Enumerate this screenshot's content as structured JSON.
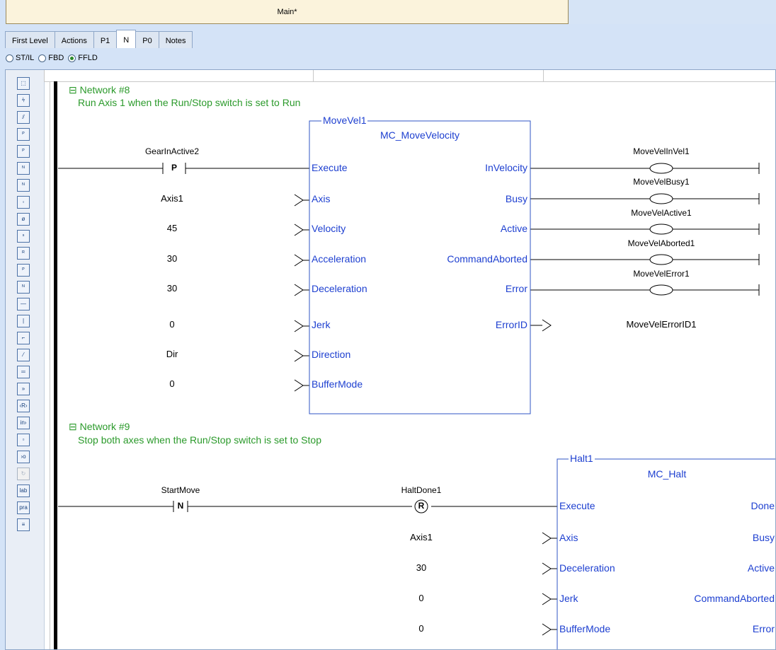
{
  "window": {
    "title": "Main*"
  },
  "tabs": [
    "First Level",
    "Actions",
    "P1",
    "N",
    "P0",
    "Notes"
  ],
  "active_tab": "N",
  "language_options": [
    {
      "label": "ST/IL",
      "selected": false
    },
    {
      "label": "FBD",
      "selected": false
    },
    {
      "label": "FFLD",
      "selected": true
    }
  ],
  "toolbar_icons": [
    "select-icon",
    "contact-icon",
    "negated-contact-icon",
    "pulse-contact-icon",
    "negated-pulse-contact-icon",
    "falling-contact-icon",
    "negated-falling-contact-icon",
    "coil-icon",
    "negated-coil-icon",
    "set-coil-icon",
    "reset-coil-icon",
    "pulse-coil-icon",
    "falling-coil-icon",
    "horizontal-line-icon",
    "vertical-line-icon",
    "step-icon",
    "diagonal-icon",
    "block-icon",
    "jump-icon",
    "return-icon",
    "input-variable-icon",
    "variable-icon",
    "output-variable-icon",
    "loop-icon",
    "label-icon",
    "pragma-icon",
    "more-icon"
  ],
  "colors": {
    "wire": "#000000",
    "block_border": "#2f56c6",
    "block_text": "#1d3fd0",
    "comment": "#2b9a2b",
    "network_header": "#2b9a2b"
  },
  "networks": [
    {
      "header": "Network #8",
      "comment": "Run Axis 1 when the Run/Stop switch is set to Run",
      "block": {
        "instance": "MoveVel1",
        "type": "MC_MoveVelocity",
        "inputs": [
          "Execute",
          "Axis",
          "Velocity",
          "Acceleration",
          "Deceleration",
          "Jerk",
          "Direction",
          "BufferMode"
        ],
        "outputs": [
          "InVelocity",
          "Busy",
          "Active",
          "CommandAborted",
          "Error",
          "ErrorID"
        ]
      },
      "contact": {
        "label": "GearInActive2",
        "symbol": "P"
      },
      "input_values": [
        "Axis1",
        "45",
        "30",
        "30",
        "0",
        "Dir",
        "0"
      ],
      "coils": [
        "MoveVelInVel1",
        "MoveVelBusy1",
        "MoveVelActive1",
        "MoveVelAborted1",
        "MoveVelError1"
      ],
      "output_variable": "MoveVelErrorID1"
    },
    {
      "header": "Network #9",
      "comment": "Stop both axes when the Run/Stop switch is set to Stop",
      "block": {
        "instance": "Halt1",
        "type": "MC_Halt",
        "inputs": [
          "Execute",
          "Axis",
          "Deceleration",
          "Jerk",
          "BufferMode"
        ],
        "outputs": [
          "Done",
          "Busy",
          "Active",
          "CommandAborted",
          "Error"
        ]
      },
      "contact": {
        "label": "StartMove",
        "symbol": "N"
      },
      "coil": {
        "label": "HaltDone1",
        "symbol": "R"
      },
      "input_values": [
        "Axis1",
        "30",
        "0",
        "0"
      ]
    }
  ]
}
